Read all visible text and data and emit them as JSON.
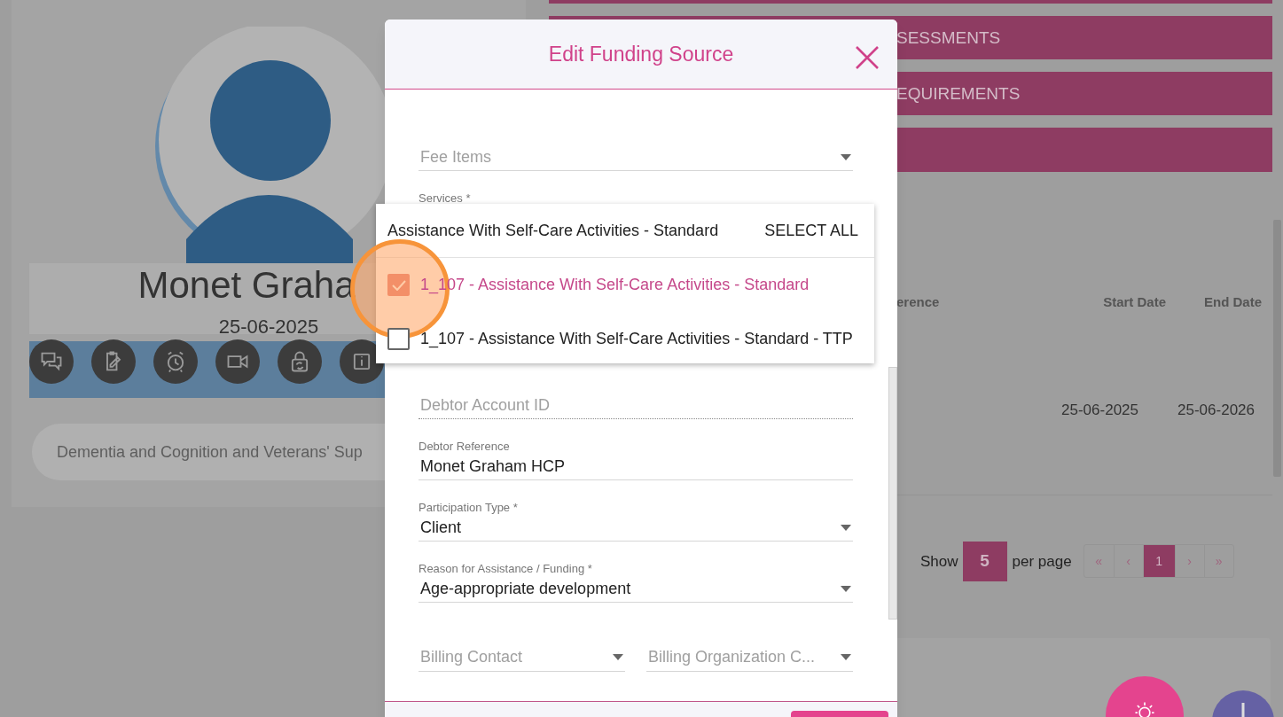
{
  "profile": {
    "name": "Monet Graha",
    "date": "25-06-2025",
    "tag": "Dementia and Cognition and Veterans' Sup"
  },
  "section_bars": [
    "SESSMENTS",
    "EQUIREMENTS"
  ],
  "table": {
    "columns": [
      "erence",
      "Start Date",
      "End Date"
    ],
    "rows": [
      {
        "start": "25-06-2025",
        "end": "25-06-2026"
      }
    ]
  },
  "pagination": {
    "show": "Show",
    "page_size": "5",
    "per_page": "per page",
    "pages": [
      {
        "label": "«",
        "selected": false
      },
      {
        "label": "‹",
        "selected": false
      },
      {
        "label": "1",
        "selected": true
      },
      {
        "label": "›",
        "selected": false
      },
      {
        "label": "»",
        "selected": false
      }
    ]
  },
  "modal": {
    "title": "Edit Funding Source",
    "fields": [
      {
        "kind": "select",
        "placeholder": "Fee Items"
      },
      {
        "kind": "multiselect",
        "label": "Services *"
      },
      {
        "kind": "readonly",
        "placeholder": "Debtor Account ID"
      },
      {
        "kind": "text",
        "label": "Debtor Reference",
        "value": "Monet Graham HCP"
      },
      {
        "kind": "select",
        "label": "Participation Type *",
        "value": "Client"
      },
      {
        "kind": "select",
        "label": "Reason for Assistance / Funding *",
        "value": "Age-appropriate development"
      }
    ],
    "billing_row": [
      {
        "placeholder": "Billing Contact"
      },
      {
        "placeholder": "Billing Organization C..."
      }
    ]
  },
  "dropdown": {
    "search": "Assistance With Self-Care Activities - Standard",
    "select_all": "SELECT ALL",
    "options": [
      {
        "label": "1_107 - Assistance With Self-Care Activities - Standard",
        "checked": true
      },
      {
        "label": "1_107 - Assistance With Self-Care Activities - Standard - TTP",
        "checked": false
      }
    ]
  }
}
